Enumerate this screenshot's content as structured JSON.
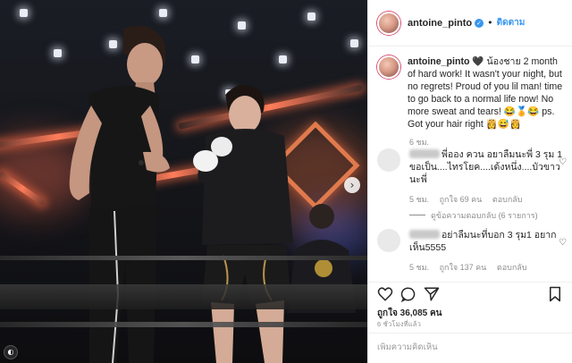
{
  "post": {
    "username": "antoine_pinto",
    "follow_label": "ติดตาม",
    "separator": "•",
    "caption_username": "antoine_pinto",
    "caption_text": "🖤 น้องชาย 2 month of hard work! It wasn't your night, but no regrets! Proud of you lil man! time to go back to a normal life now! No more sweat and tears! 😂🏅😂 ps. Got your hair right 👸😅👸",
    "caption_time": "6 ชม.",
    "likes": "ถูกใจ 36,085 คน",
    "time_ago": "6 ชั่วโมงที่แล้ว",
    "add_comment_placeholder": "เพิ่มความคิดเห็น"
  },
  "comments": [
    {
      "text": "พี่ออง ควน อยาลืมนะพี่ 3 รุม 1 ขอเป็น....ไทรโยค....เด้งหนึ่ง....บัวขาว นะพี่",
      "time": "5 ชม.",
      "likes": "ถูกใจ 69 คน",
      "reply": "ตอบกลับ",
      "view_replies": "ดูข้อความตอบกลับ (6 รายการ)"
    },
    {
      "text": "อย่าลืมนะที่บอก 3 รุม1 อยากเห็น5555",
      "time": "5 ชม.",
      "likes": "ถูกใจ 137 คน",
      "reply": "ตอบกลับ"
    }
  ],
  "icons": {
    "verified": "verified-check-icon",
    "like": "heart-icon",
    "comment": "comment-bubble-icon",
    "share": "paper-plane-icon",
    "save": "bookmark-icon",
    "next": "chevron-right-icon",
    "close": "close-icon"
  },
  "colors": {
    "link": "#3897f0",
    "text": "#262626",
    "muted": "#8e8e8e",
    "stage_accent": "#ff7d5a"
  }
}
